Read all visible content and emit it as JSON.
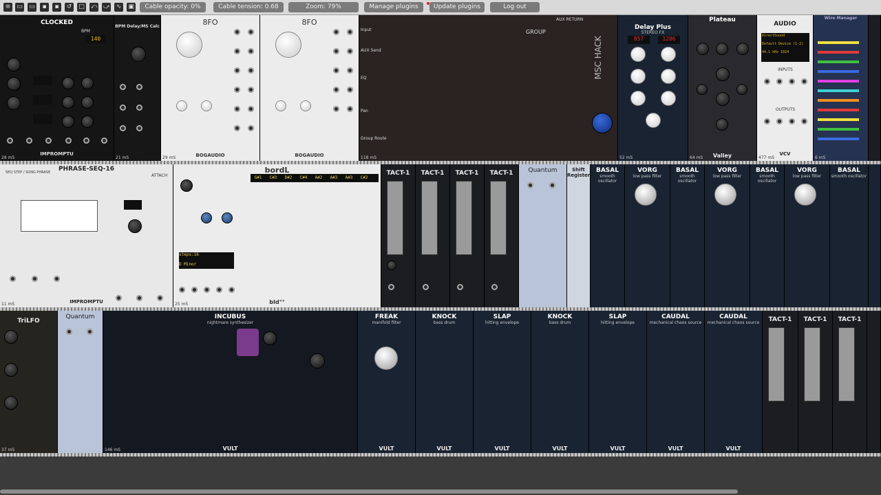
{
  "toolbar": {
    "icons": [
      "menu-icon",
      "open-icon",
      "save-icon",
      "save-as-icon",
      "revert-icon",
      "new-patch-icon",
      "undo-icon",
      "redo-icon",
      "cable-icon",
      "lock-icon"
    ],
    "cable_opacity": "Cable opacity: 0%",
    "cable_tension": "Cable tension: 0.68",
    "zoom": "Zoom: 79%",
    "manage_plugins": "Manage plugins",
    "update_plugins": "Update plugins",
    "logout": "Log out"
  },
  "modules": {
    "clocked": {
      "title": "CLOCKED",
      "bpm_label": "BPM",
      "bpm": "140",
      "brand": "IMPROMPTU",
      "ms": "28 mS"
    },
    "bpm_delay": {
      "title": "BPM Delay/MS Calc",
      "ms": "21 mS"
    },
    "eightfo_1": {
      "title": "8FO",
      "brand": "BOGAUDIO",
      "ms": "29 mS"
    },
    "eightfo_2": {
      "title": "8FO",
      "brand": "BOGAUDIO",
      "ms": ""
    },
    "mixer": {
      "labels": [
        "Input",
        "AUX Send",
        "EQ",
        "Pan",
        "Group Route"
      ],
      "group": "GROUP",
      "aux_return": "AUX RETURN",
      "brand": "MSC HACK",
      "ms": "118 mS"
    },
    "delay_plus": {
      "title": "Delay Plus",
      "sub": "STEREO FX",
      "left_ms": "857",
      "right_ms": "1286",
      "ms": "52 mS"
    },
    "plateau": {
      "title": "Plateau",
      "brand": "Valley",
      "ms": "64 mS"
    },
    "audio": {
      "title": "AUDIO",
      "driver": "DirectSound",
      "device": "Default Device (1-2)",
      "rate": "44.1 kHz  1024",
      "inputs": "INPUTS",
      "outputs": "OUTPUTS",
      "brand": "VCV",
      "ms": "477 mS"
    },
    "wire_manager": {
      "title": "Wire Manager",
      "ms": "6 mS"
    },
    "phrase_seq": {
      "title": "PHRASE-SEQ-16",
      "sub": "SEQ STEP / SONG PHRASE",
      "attach": "ATTACH",
      "brand": "IMPROMPTU",
      "ms": "11 mS"
    },
    "bordl": {
      "title": "bordL",
      "notes": [
        "G#1",
        "C#3",
        "D#2",
        "C#4",
        "A#2",
        "A#3",
        "A#3",
        "C#2"
      ],
      "steps": "steps:16",
      "scale": "D Minor",
      "brand": "bId°°",
      "ms": "25 mS"
    },
    "tact_1": {
      "title": "TACT-1"
    },
    "quantum": {
      "title": "Quantum"
    },
    "shift_register": {
      "title": "Shift Register"
    },
    "basal": {
      "title": "BASAL",
      "sub": "smooth oscillator"
    },
    "vorg": {
      "title": "VORG",
      "sub": "low pass filter"
    },
    "trilfo": {
      "title": "TriLFO",
      "ms": "37 mS"
    },
    "incubus": {
      "title": "INCUBUS",
      "sub": "nightmare synthesizer",
      "brand": "VULT",
      "ms": "146 mS"
    },
    "freak": {
      "title": "FREAK",
      "sub": "manifold filter",
      "brand": "VULT"
    },
    "knock": {
      "title": "KNOCK",
      "sub": "bass drum",
      "brand": "VULT"
    },
    "slap": {
      "title": "SLAP",
      "sub": "hitting envelope",
      "brand": "VULT"
    },
    "caudal": {
      "title": "CAUDAL",
      "sub": "mechanical chaos source",
      "brand": "VULT"
    }
  }
}
